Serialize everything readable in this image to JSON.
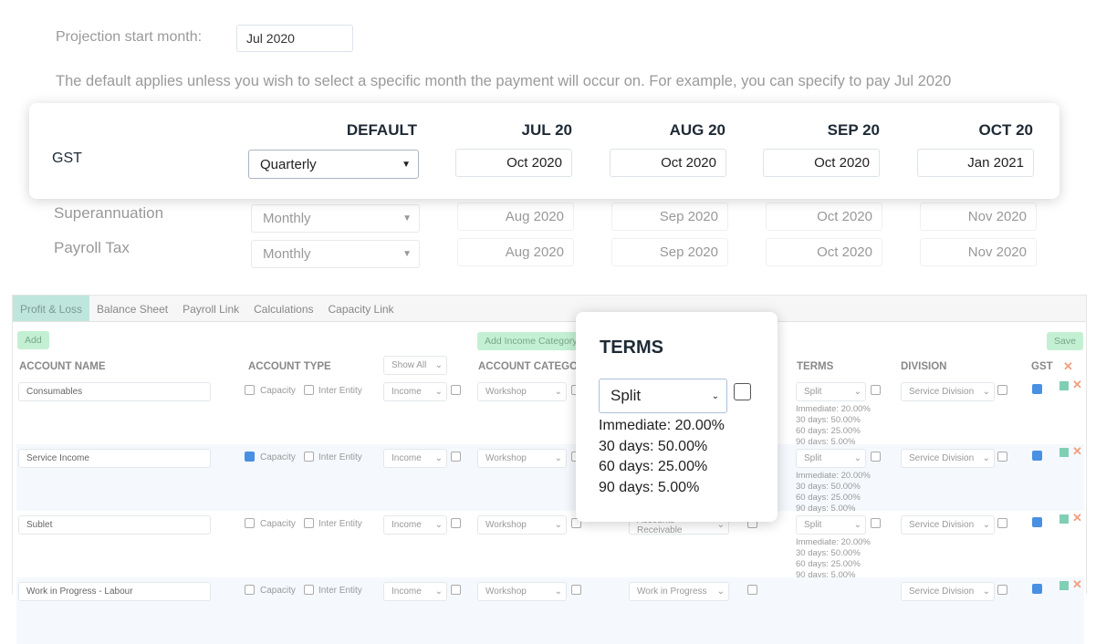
{
  "projection": {
    "label": "Projection start month:",
    "value": "Jul 2020"
  },
  "description": "The default applies unless you wish to select a specific month the payment will occur on. For example, you can specify to pay Jul 2020",
  "schedule": {
    "headers": [
      "DEFAULT",
      "JUL 20",
      "AUG 20",
      "SEP 20",
      "OCT 20"
    ],
    "rows": [
      {
        "name": "GST",
        "default": "Quarterly",
        "months": [
          "Oct 2020",
          "Oct 2020",
          "Oct 2020",
          "Jan 2021"
        ]
      },
      {
        "name": "Superannuation",
        "default": "Monthly",
        "months": [
          "Aug 2020",
          "Sep 2020",
          "Oct 2020",
          "Nov 2020"
        ]
      },
      {
        "name": "Payroll Tax",
        "default": "Monthly",
        "months": [
          "Aug 2020",
          "Sep 2020",
          "Oct 2020",
          "Nov 2020"
        ]
      }
    ]
  },
  "tabs": [
    "Profit & Loss",
    "Balance Sheet",
    "Payroll Link",
    "Calculations",
    "Capacity Link"
  ],
  "buttons": {
    "add": "Add",
    "add_income_category": "Add Income Category",
    "save": "Save"
  },
  "columns": {
    "account_name": "ACCOUNT NAME",
    "account_type": "ACCOUNT TYPE",
    "filter": "Show All",
    "account_category": "ACCOUNT CATEGORY",
    "terms": "TERMS",
    "division": "DIVISION",
    "gst": "GST"
  },
  "labels": {
    "capacity": "Capacity",
    "inter_entity": "Inter Entity"
  },
  "accounts": [
    {
      "name": "Consumables",
      "capacity": false,
      "type": "Income",
      "category": "Workshop",
      "category2": "",
      "terms": "Split",
      "division": "Service Division",
      "gst": true
    },
    {
      "name": "Service Income",
      "capacity": true,
      "type": "Income",
      "category": "Workshop",
      "category2": "",
      "terms": "Split",
      "division": "Service Division",
      "gst": true
    },
    {
      "name": "Sublet",
      "capacity": false,
      "type": "Income",
      "category": "Workshop",
      "category2": "Accounts Receivable",
      "terms": "Split",
      "division": "Service Division",
      "gst": true
    },
    {
      "name": "Work in Progress - Labour",
      "capacity": false,
      "type": "Income",
      "category": "Workshop",
      "category2": "Work in Progress",
      "terms": "",
      "division": "Service Division",
      "gst": true
    }
  ],
  "split_lines": [
    "Immediate: 20.00%",
    "30 days: 50.00%",
    "60 days: 25.00%",
    "90 days: 5.00%"
  ],
  "popup": {
    "title": "TERMS",
    "value": "Split",
    "lines": [
      "Immediate: 20.00%",
      "30 days: 50.00%",
      "60 days: 25.00%",
      "90 days: 5.00%"
    ]
  },
  "colors": {
    "accent_green": "#c3f0d3",
    "tab_active": "#bfe6dd",
    "checkbox": "#4a90e2",
    "delete": "#f0a080",
    "archive": "#7fcfb5"
  }
}
